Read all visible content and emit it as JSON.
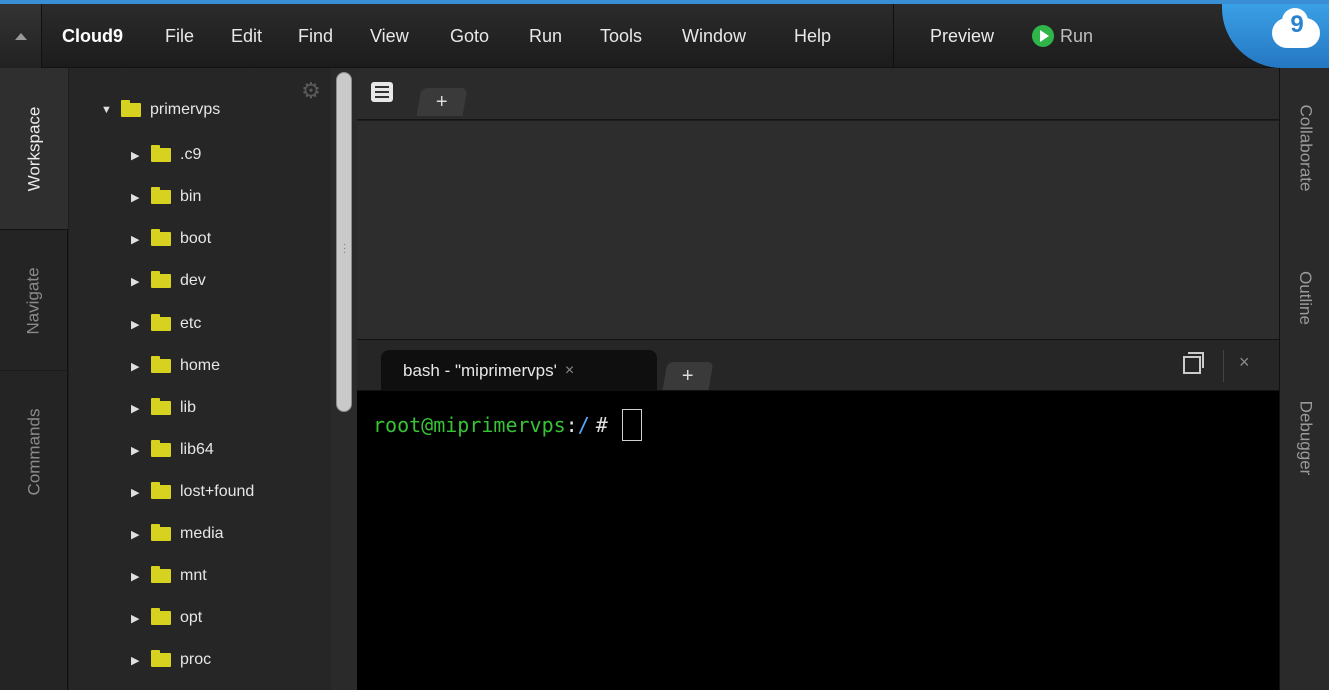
{
  "menubar": {
    "brand": "Cloud9",
    "items": [
      "File",
      "Edit",
      "Find",
      "View",
      "Goto",
      "Run",
      "Tools",
      "Window",
      "Help"
    ],
    "preview_label": "Preview",
    "run_label": "Run"
  },
  "logo": {
    "text": "9"
  },
  "left_tabs": {
    "workspace": "Workspace",
    "navigate": "Navigate",
    "commands": "Commands"
  },
  "tree": {
    "root": "primervps",
    "items": [
      ".c9",
      "bin",
      "boot",
      "dev",
      "etc",
      "home",
      "lib",
      "lib64",
      "lost+found",
      "media",
      "mnt",
      "opt",
      "proc"
    ]
  },
  "editor": {
    "add_tab_label": "+"
  },
  "terminal": {
    "tab_title": "bash - \"miprimervps'",
    "tab_close": "×",
    "add_tab_label": "+",
    "close_label": "×",
    "prompt_user": "root@miprimervps",
    "prompt_sep": ":",
    "prompt_path": "/",
    "prompt_hash": "#"
  },
  "right_tabs": {
    "collaborate": "Collaborate",
    "outline": "Outline",
    "debugger": "Debugger"
  },
  "colors": {
    "accent": "#3a8fd4",
    "folder": "#d6d21f",
    "prompt_user": "#36c336",
    "prompt_path": "#5aa7ff",
    "run_green": "#2fb54a"
  }
}
